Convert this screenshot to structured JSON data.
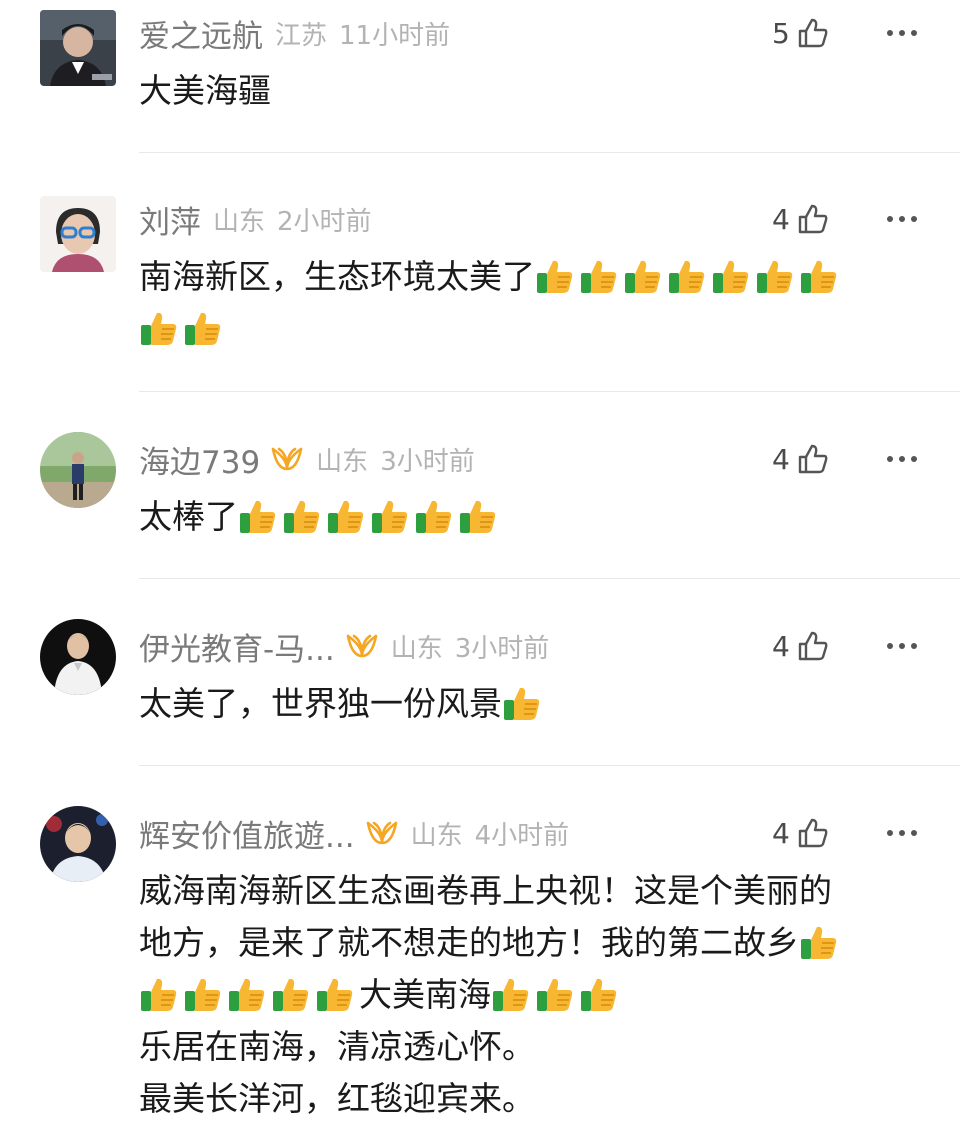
{
  "comments": [
    {
      "username": "爱之远航",
      "location": "江苏",
      "time": "11小时前",
      "likes": "5",
      "verified": false,
      "avatar_style": "square",
      "lines": [
        [
          "大美海疆"
        ]
      ]
    },
    {
      "username": "刘萍",
      "location": "山东",
      "time": "2小时前",
      "likes": "4",
      "verified": false,
      "avatar_style": "square",
      "lines": [
        [
          "南海新区，生态环境太美了",
          "👍",
          "👍",
          "👍",
          "👍",
          "👍",
          "👍",
          "👍"
        ],
        [
          "👍",
          "👍"
        ]
      ]
    },
    {
      "username": "海边739",
      "location": "山东",
      "time": "3小时前",
      "likes": "4",
      "verified": true,
      "avatar_style": "round",
      "lines": [
        [
          "太棒了",
          "👍",
          "👍",
          "👍",
          "👍",
          "👍",
          "👍"
        ]
      ]
    },
    {
      "username": "伊光教育-马...",
      "location": "山东",
      "time": "3小时前",
      "likes": "4",
      "verified": true,
      "avatar_style": "round",
      "lines": [
        [
          "太美了，世界独一份风景",
          "👍"
        ]
      ]
    },
    {
      "username": "辉安价值旅遊...",
      "location": "山东",
      "time": "4小时前",
      "likes": "4",
      "verified": true,
      "avatar_style": "round",
      "lines": [
        [
          "威海南海新区生态画卷再上央视！这是个美丽的"
        ],
        [
          "地方，是来了就不想走的地方！我的第二故乡",
          "👍"
        ],
        [
          "👍",
          "👍",
          "👍",
          "👍",
          "👍",
          "大美南海",
          "👍",
          "👍",
          "👍"
        ],
        [
          "乐居在南海，清凉透心怀。"
        ],
        [
          "最美长洋河，红毯迎宾来。"
        ]
      ]
    }
  ],
  "icons": {
    "like": "thumbs-up-outline-icon",
    "more": "more-dots-icon",
    "verified": "verified-badge-icon",
    "emoji": "thumbs-up-emoji"
  },
  "colors": {
    "username": "#7a7a7a",
    "meta": "#b3b3b3",
    "badge": "#f5a623",
    "divider": "#e8e8e8"
  }
}
